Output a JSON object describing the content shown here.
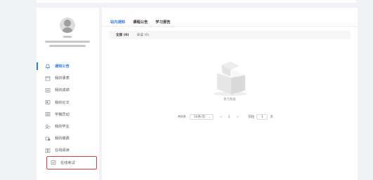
{
  "tabs": [
    {
      "label": "站内通知"
    },
    {
      "label": "课程公告"
    },
    {
      "label": "学习报告"
    }
  ],
  "filters": [
    {
      "label": "全部 (0)"
    },
    {
      "label": "未读 (0)"
    }
  ],
  "sidebar": {
    "items": [
      {
        "label": "通知公告",
        "icon": "bell-icon"
      },
      {
        "label": "我的课表",
        "icon": "calendar-icon"
      },
      {
        "label": "我的成绩",
        "icon": "grade-icon"
      },
      {
        "label": "我的论文",
        "icon": "document-icon"
      },
      {
        "label": "学籍异动",
        "icon": "list-icon"
      },
      {
        "label": "我的毕业",
        "icon": "graduation-icon"
      },
      {
        "label": "我的缴费",
        "icon": "payment-icon"
      },
      {
        "label": "在线阅读",
        "icon": "book-icon"
      },
      {
        "label": "在线考试",
        "icon": "exam-icon"
      }
    ]
  },
  "empty_text": "暂无数据",
  "pagination": {
    "total": "共0条",
    "page_size": "10条/页",
    "prev": "<",
    "current": "1",
    "next": ">",
    "jump_label": "前往",
    "jump_value": "1",
    "page_unit": "页"
  },
  "colors": {
    "accent": "#2d7be5",
    "highlight_border": "#e23b3b"
  }
}
